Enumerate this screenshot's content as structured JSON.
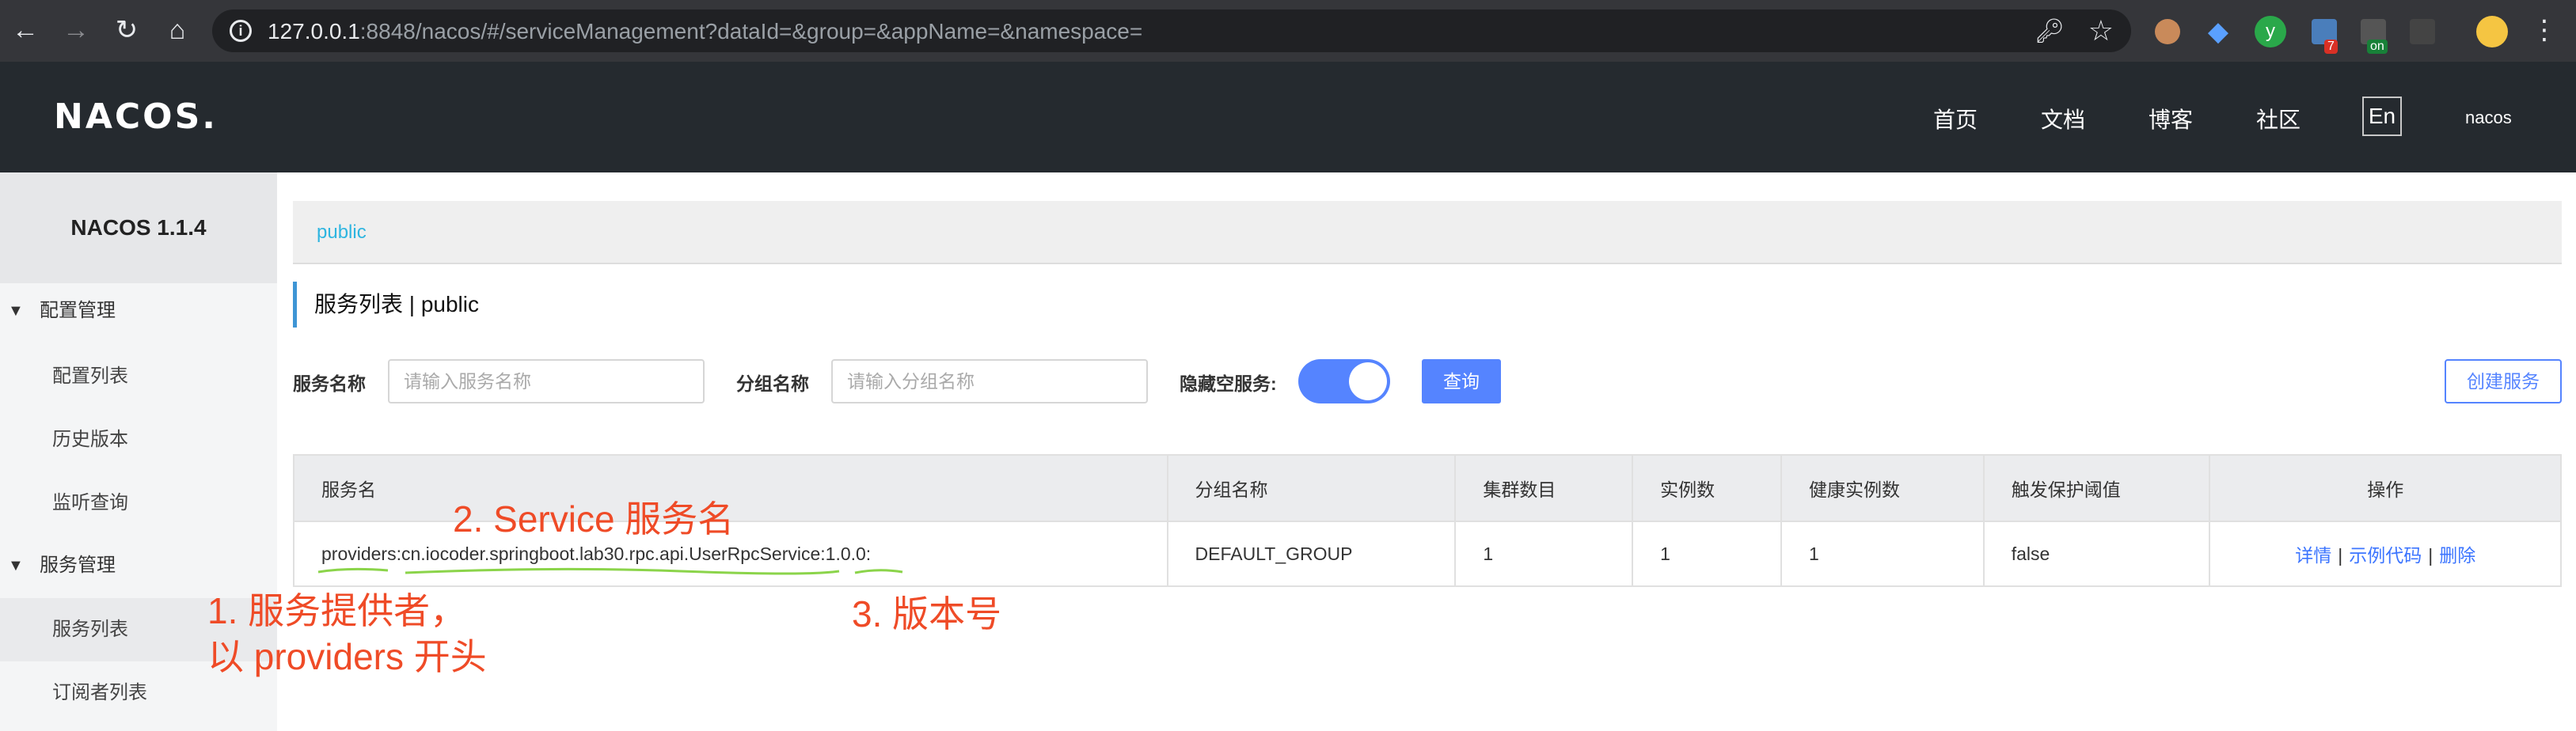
{
  "browser": {
    "url_host": "127.0.0.1",
    "url_rest": ":8848/nacos/#/serviceManagement?dataId=&group=&appName=&namespace=",
    "ext_badges": [
      "7",
      "on"
    ]
  },
  "header": {
    "logo": "NACOS.",
    "nav": [
      "首页",
      "文档",
      "博客",
      "社区"
    ],
    "lang": "En",
    "user": "nacos"
  },
  "sidebar": {
    "brand": "NACOS 1.1.4",
    "config_group": "配置管理",
    "config_items": [
      "配置列表",
      "历史版本",
      "监听查询"
    ],
    "service_group": "服务管理",
    "service_items": [
      "服务列表",
      "订阅者列表"
    ]
  },
  "main": {
    "namespace": "public",
    "title": "服务列表  |  public",
    "filters": {
      "service_name_label": "服务名称",
      "service_name_placeholder": "请输入服务名称",
      "group_name_label": "分组名称",
      "group_name_placeholder": "请输入分组名称",
      "hide_empty_label": "隐藏空服务:",
      "hide_empty_on": true,
      "query_button": "查询",
      "create_button": "创建服务"
    },
    "table": {
      "headers": [
        "服务名",
        "分组名称",
        "集群数目",
        "实例数",
        "健康实例数",
        "触发保护阈值",
        "操作"
      ],
      "rows": [
        {
          "service_name": "providers:cn.iocoder.springboot.lab30.rpc.api.UserRpcService:1.0.0:",
          "group": "DEFAULT_GROUP",
          "clusters": "1",
          "instances": "1",
          "healthy": "1",
          "threshold": "false",
          "ops": [
            "详情",
            "示例代码",
            "删除"
          ]
        }
      ]
    }
  },
  "annotations": {
    "a2": "2. Service 服务名",
    "a1_line1": "1. 服务提供者，",
    "a1_line2": "以 providers 开头",
    "a3": "3. 版本号",
    "color": "#ef4b27",
    "underline_color": "#8bd44a"
  }
}
